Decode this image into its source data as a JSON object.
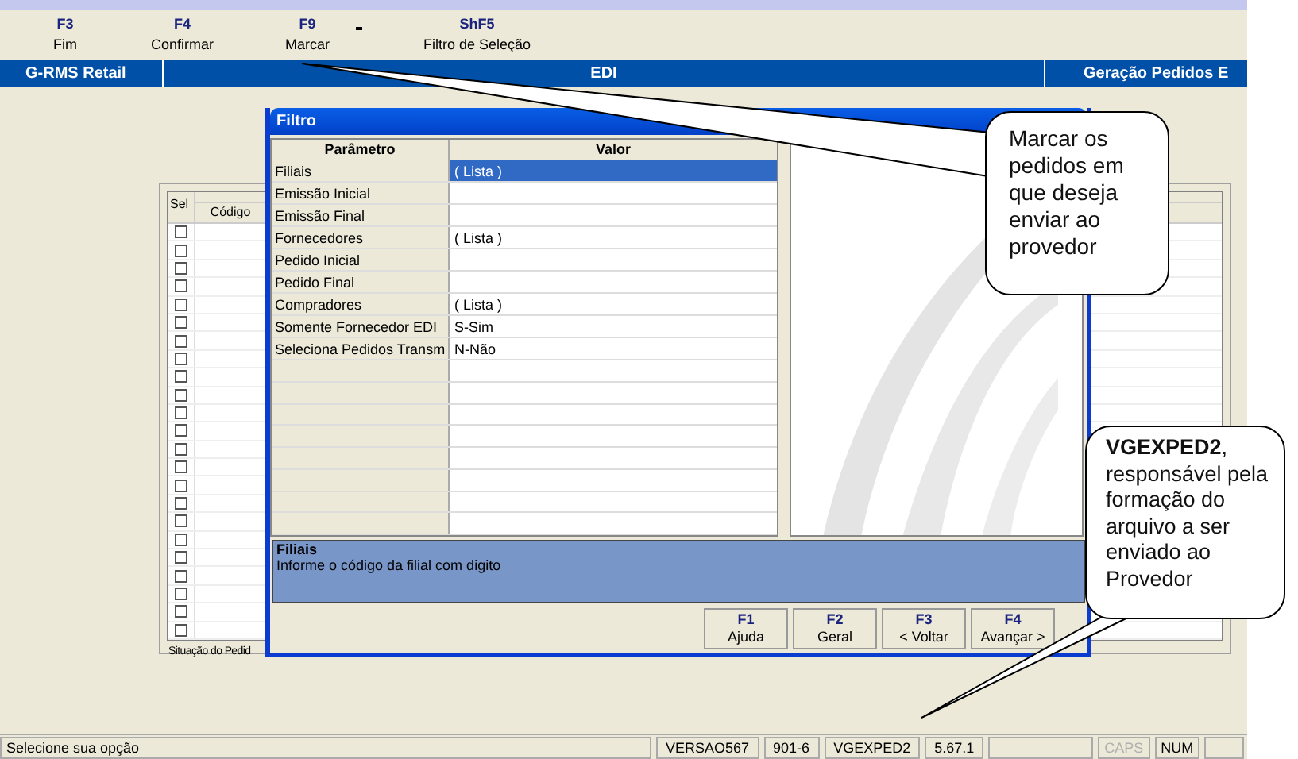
{
  "toolbar": [
    {
      "key": "F3",
      "label": "Fim"
    },
    {
      "key": "F4",
      "label": "Confirmar"
    },
    {
      "key": "F9",
      "label": "Marcar"
    },
    {
      "key": "ShF5",
      "label": "Filtro de Seleção"
    }
  ],
  "header": {
    "app": "G-RMS Retail",
    "module": "EDI",
    "screen": "Geração Pedidos E"
  },
  "grid": {
    "columns": [
      "Sel",
      "Código"
    ],
    "footer": "Situação do Pedid",
    "rows": [
      {
        "checked": false
      },
      {
        "checked": false
      },
      {
        "checked": false
      },
      {
        "checked": false
      },
      {
        "checked": false
      },
      {
        "checked": false
      },
      {
        "checked": false
      },
      {
        "checked": false
      },
      {
        "checked": false
      },
      {
        "checked": false
      },
      {
        "checked": false
      },
      {
        "checked": false
      },
      {
        "checked": false
      },
      {
        "checked": false
      },
      {
        "checked": false
      },
      {
        "checked": false
      },
      {
        "checked": false
      },
      {
        "checked": false
      },
      {
        "checked": false
      },
      {
        "checked": false
      },
      {
        "checked": false
      },
      {
        "checked": false
      },
      {
        "checked": false
      }
    ]
  },
  "dialog": {
    "title": "Filtro",
    "columns": [
      "Parâmetro",
      "Valor"
    ],
    "rows": [
      {
        "parameter": "Filiais",
        "value": "( Lista )",
        "selected": true
      },
      {
        "parameter": "Emissão Inicial",
        "value": "",
        "selected": false
      },
      {
        "parameter": "Emissão Final",
        "value": "",
        "selected": false
      },
      {
        "parameter": "Fornecedores",
        "value": "( Lista )",
        "selected": false
      },
      {
        "parameter": "Pedido Inicial",
        "value": "",
        "selected": false
      },
      {
        "parameter": "Pedido Final",
        "value": "",
        "selected": false
      },
      {
        "parameter": "Compradores",
        "value": "( Lista )",
        "selected": false
      },
      {
        "parameter": "Somente Fornecedor EDI",
        "value": "S-Sim",
        "selected": false
      },
      {
        "parameter": "Seleciona Pedidos Transm",
        "value": "N-Não",
        "selected": false
      }
    ],
    "help_title": "Filiais",
    "help_text": "Informe o código da filial com digito",
    "buttons": [
      {
        "key": "F1",
        "label": "Ajuda"
      },
      {
        "key": "F2",
        "label": "Geral"
      },
      {
        "key": "F3",
        "label": "< Voltar"
      },
      {
        "key": "F4",
        "label": "Avançar >"
      }
    ]
  },
  "status_bar": [
    {
      "text": "Selecione sua opção",
      "disabled": false
    },
    {
      "text": "VERSAO567",
      "disabled": false
    },
    {
      "text": "901-6",
      "disabled": false
    },
    {
      "text": "VGEXPED2",
      "disabled": false
    },
    {
      "text": "5.67.1",
      "disabled": false
    },
    {
      "text": "CAPS",
      "disabled": true
    },
    {
      "text": "NUM",
      "disabled": false
    }
  ],
  "callouts": [
    {
      "text": "Marcar os pedidos em que deseja enviar ao provedor"
    },
    {
      "text": "**VGEXPED2**, responsável pela formação do arquivo a ser enviado ao Provedor"
    }
  ]
}
